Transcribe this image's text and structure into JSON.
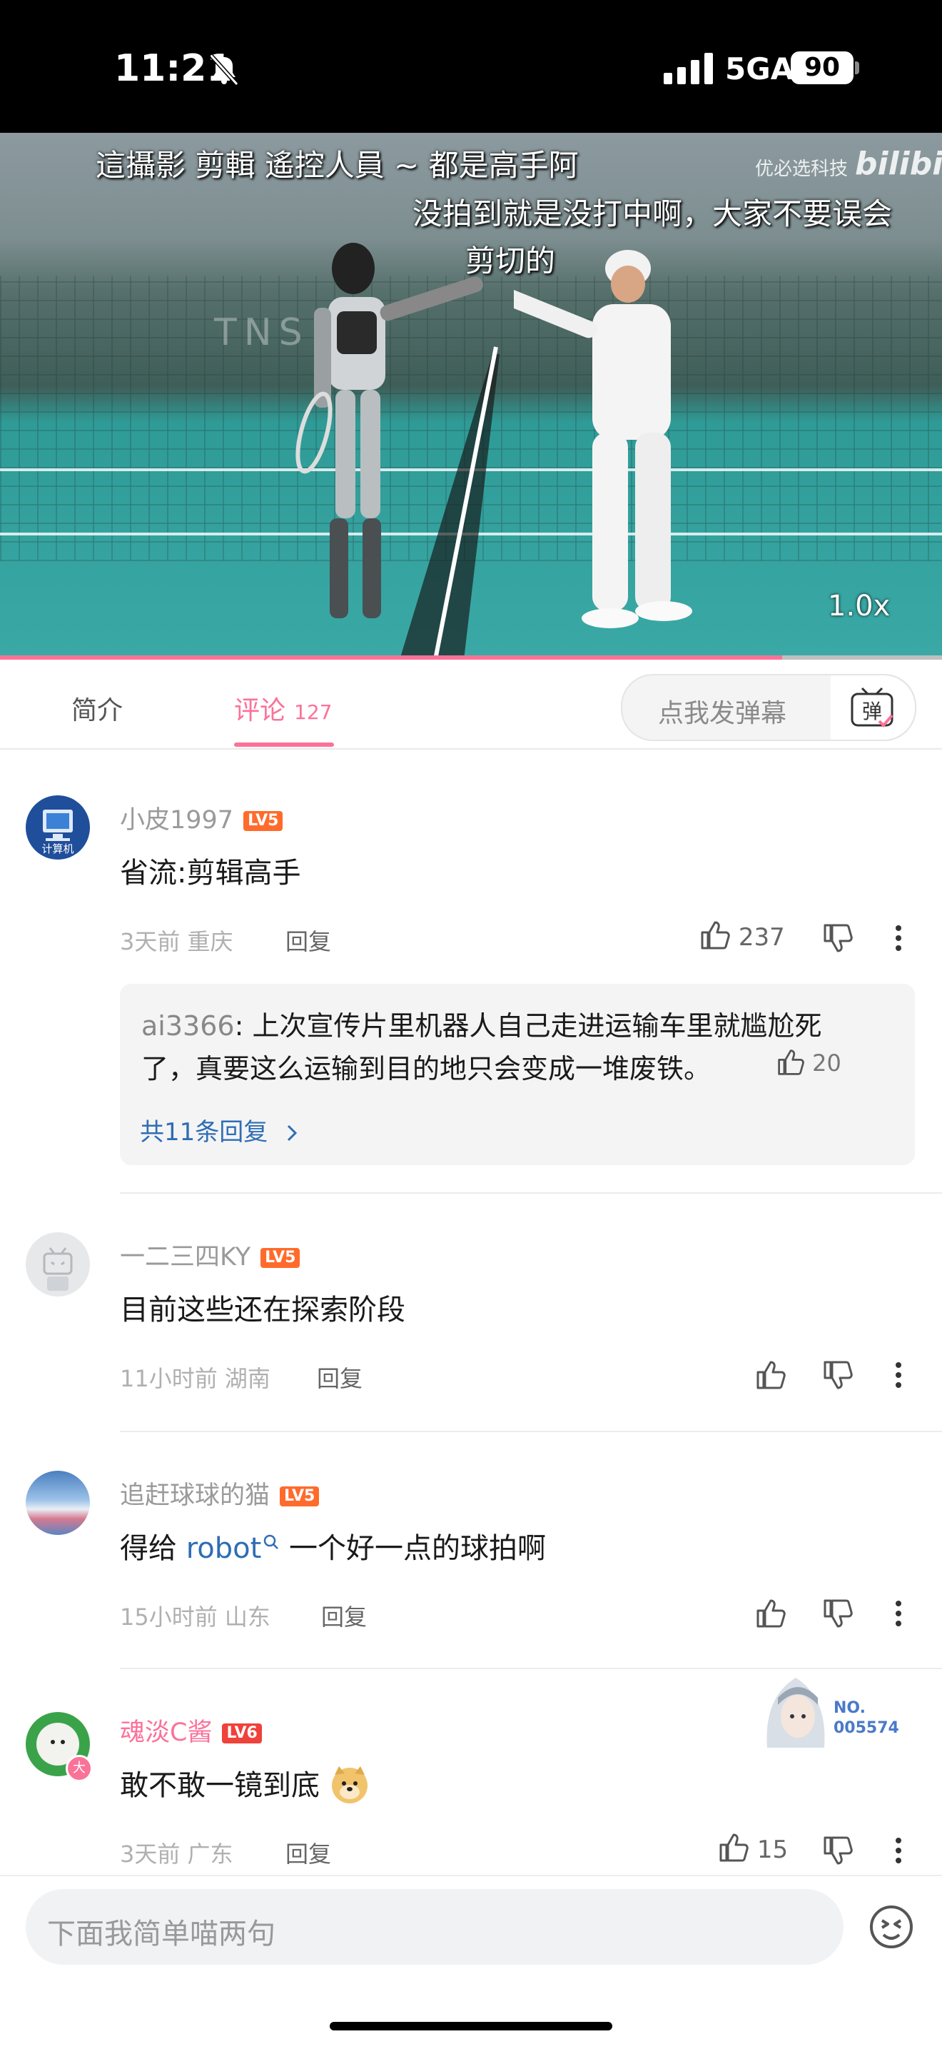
{
  "status_bar": {
    "time": "11:21",
    "network": "5GA",
    "battery": "90"
  },
  "video": {
    "subtitle_1": "這攝影 剪輯 遙控人員 ~ 都是高手阿",
    "subtitle_2": "没拍到就是没打中啊，大家不要误会",
    "subtitle_3": "剪切的",
    "watermark_text": "优必选科技",
    "watermark_logo": "bilibili",
    "court_sign": "TNS",
    "speed": "1.0x",
    "progress": 0.83
  },
  "tabs": {
    "intro": "简介",
    "comments": "评论",
    "comments_count": "127",
    "danmaku_placeholder": "点我发弹幕",
    "danmaku_icon_label": "弹"
  },
  "comments": [
    {
      "username": "小皮1997",
      "level": "LV5",
      "avatar_label": "计算机",
      "text": "省流:剪辑高手",
      "time": "3天前",
      "location": "重庆",
      "reply_label": "回复",
      "likes": "237",
      "sub_reply": {
        "author": "ai3366",
        "text_line1": ": 上次宣传片里机器人自己走进运输车里就尴尬死",
        "text_line2": "了，真要这么运输到目的地只会变成一堆废铁。",
        "likes": "20",
        "more_label": "共11条回复"
      }
    },
    {
      "username": "一二三四KY",
      "level": "LV5",
      "text": "目前这些还在探索阶段",
      "time": "11小时前",
      "location": "湖南",
      "reply_label": "回复",
      "likes": ""
    },
    {
      "username": "追赶球球的猫",
      "level": "LV5",
      "text_before": "得给 ",
      "text_link": "robot",
      "text_after": " 一个好一点的球拍啊",
      "time": "15小时前",
      "location": "山东",
      "reply_label": "回复",
      "likes": ""
    },
    {
      "username": "魂淡C酱",
      "level": "LV6",
      "avatar_badge": "大",
      "text": "敢不敢一镜到底",
      "time": "3天前",
      "location": "广东",
      "reply_label": "回复",
      "likes": "15",
      "decoration_label": "NO.",
      "decoration_number": "005574"
    }
  ],
  "comment_input": {
    "placeholder": "下面我简单喵两句"
  },
  "colors": {
    "accent_pink": "#fb7299",
    "level_orange": "#ff6b2c",
    "link_blue": "#2e6db5"
  }
}
